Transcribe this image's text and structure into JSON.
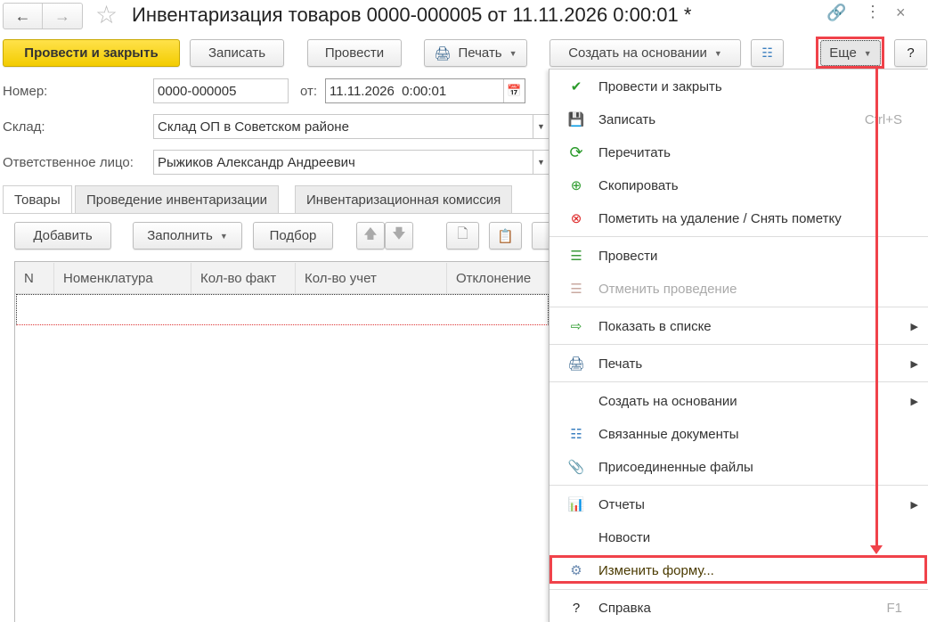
{
  "header": {
    "title": "Инвентаризация товаров 0000-000005 от 11.11.2026 0:00:01 *"
  },
  "toolbar": {
    "post_close": "Провести и закрыть",
    "save": "Записать",
    "post": "Провести",
    "print": "Печать",
    "create_based": "Создать на основании",
    "more": "Еще",
    "help": "?"
  },
  "form": {
    "number_label": "Номер:",
    "number_value": "0000-000005",
    "date_label": "от:",
    "date_value": "11.11.2026  0:00:01",
    "warehouse_label": "Склад:",
    "warehouse_value": "Склад ОП в Советском районе",
    "person_label": "Ответственное лицо:",
    "person_value": "Рыжиков Александр Андреевич"
  },
  "tabs": [
    {
      "label": "Товары"
    },
    {
      "label": "Проведение инвентаризации"
    },
    {
      "label": "Инвентаризационная комиссия"
    }
  ],
  "table_toolbar": {
    "add": "Добавить",
    "fill": "Заполнить",
    "select": "Подбор"
  },
  "table": {
    "columns": [
      "N",
      "Номенклатура",
      "Кол-во факт",
      "Кол-во учет",
      "Отклонение"
    ]
  },
  "menu": {
    "items": [
      {
        "label": "Провести и закрыть",
        "icon": "post-close-icon"
      },
      {
        "label": "Записать",
        "shortcut": "Ctrl+S",
        "icon": "save-icon"
      },
      {
        "label": "Перечитать",
        "icon": "reload-icon"
      },
      {
        "label": "Скопировать",
        "icon": "copy-icon"
      },
      {
        "label": "Пометить на удаление / Снять пометку",
        "icon": "delete-mark-icon"
      },
      {
        "label": "Провести",
        "icon": "post-icon"
      },
      {
        "label": "Отменить проведение",
        "icon": "unpost-icon",
        "disabled": true
      },
      {
        "label": "Показать в списке",
        "icon": "list-icon",
        "submenu": true
      },
      {
        "label": "Печать",
        "icon": "print-icon",
        "submenu": true
      },
      {
        "label": "Создать на основании",
        "submenu": true
      },
      {
        "label": "Связанные документы",
        "icon": "related-docs-icon"
      },
      {
        "label": "Присоединенные файлы",
        "icon": "paperclip-icon"
      },
      {
        "label": "Отчеты",
        "icon": "reports-icon",
        "submenu": true
      },
      {
        "label": "Новости"
      },
      {
        "label": "Изменить форму...",
        "icon": "settings-icon",
        "highlighted": true
      },
      {
        "label": "Справка",
        "shortcut": "F1",
        "icon": "help-icon"
      }
    ]
  },
  "colors": {
    "accent_yellow": "#f3cc00",
    "highlight_red": "#f0424a"
  }
}
